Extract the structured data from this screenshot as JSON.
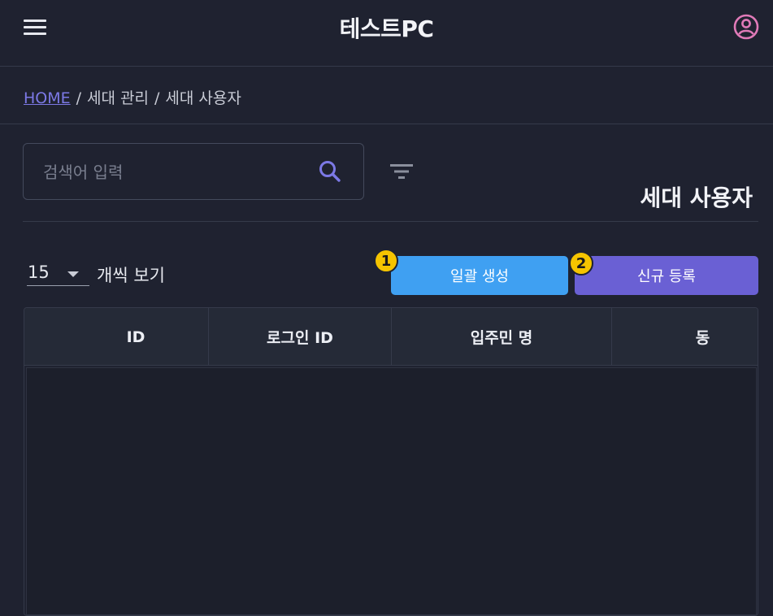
{
  "header": {
    "title": "테스트PC",
    "menu_icon": "hamburger-menu-icon",
    "profile_icon": "user-circle-icon",
    "profile_color": "#e07ab8"
  },
  "breadcrumb": {
    "home": "HOME",
    "separator": "/",
    "level1": "세대 관리",
    "level2": "세대 사용자"
  },
  "search": {
    "placeholder": "검색어 입력",
    "value": "",
    "icon": "search-icon",
    "icon_color": "#7c79e6"
  },
  "filter_icon": "filter-icon",
  "page_title": "세대 사용자",
  "pagination": {
    "page_size": "15",
    "label": "개씩 보기"
  },
  "actions": {
    "bulk_create": {
      "label": "일괄 생성",
      "badge": "1",
      "color": "#3fa0f2"
    },
    "new_register": {
      "label": "신규 등록",
      "badge": "2",
      "color": "#6a60d4"
    }
  },
  "table": {
    "columns": [
      "ID",
      "로그인 ID",
      "입주민 명",
      "동"
    ],
    "rows": []
  }
}
